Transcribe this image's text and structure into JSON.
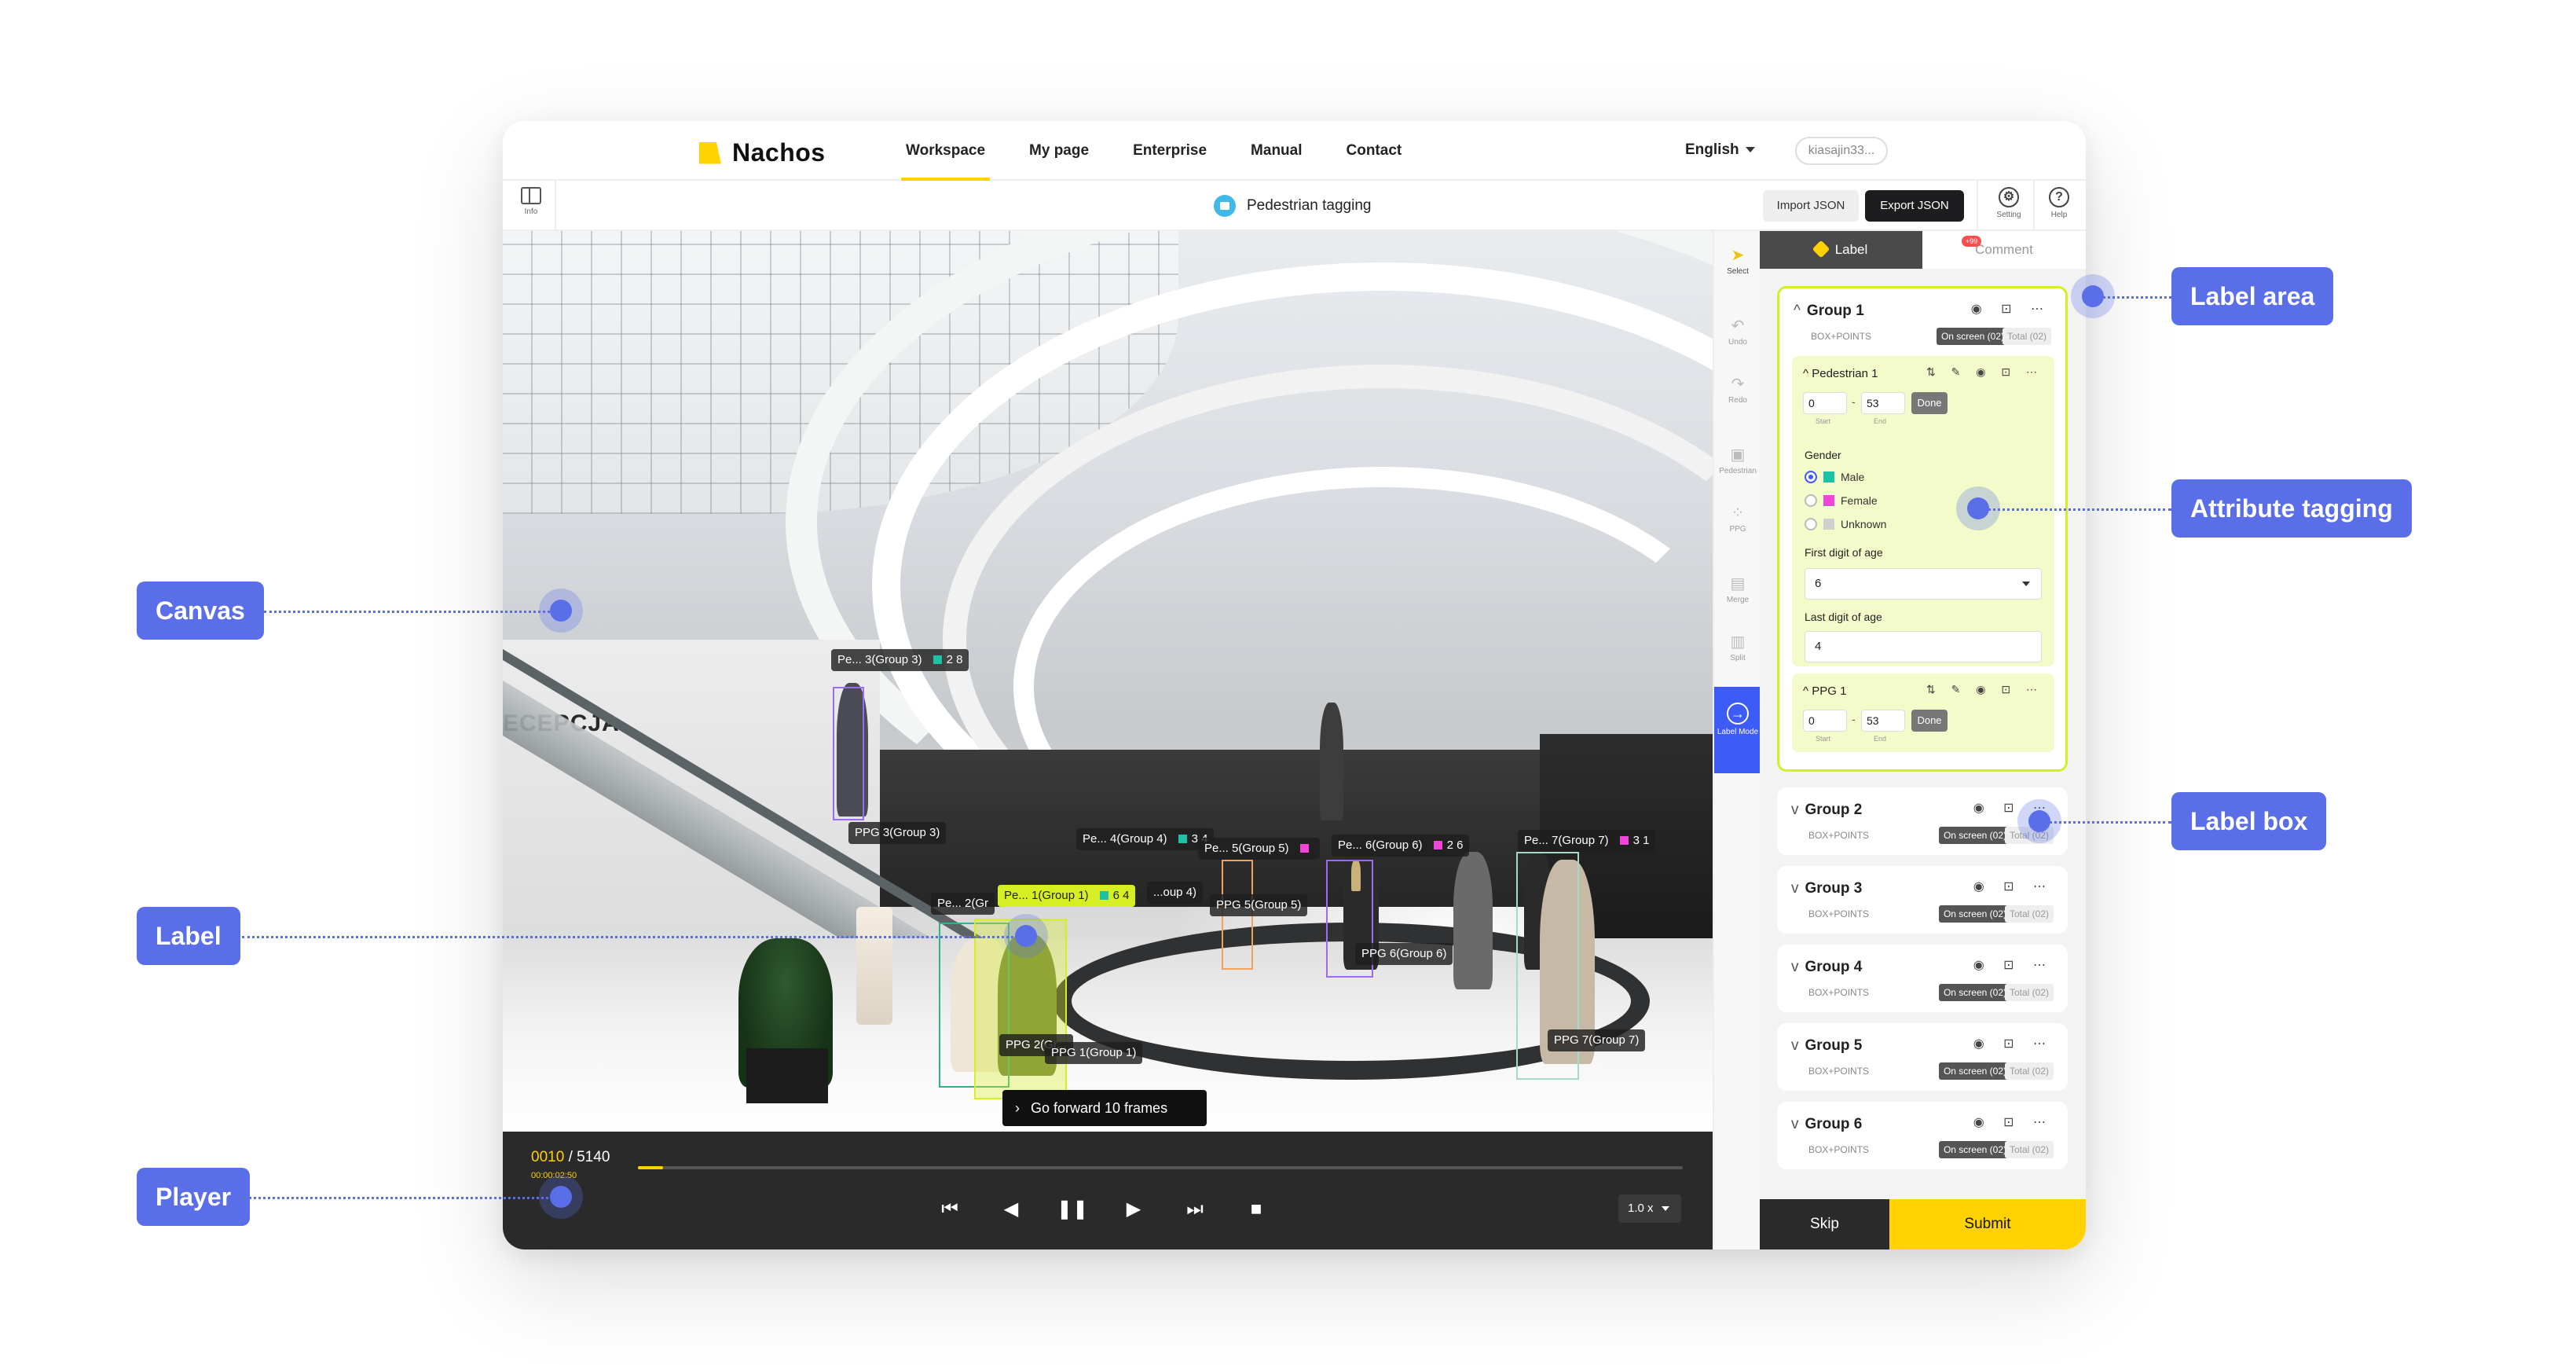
{
  "brand": {
    "name": "Nachos"
  },
  "nav": {
    "links": [
      "Workspace",
      "My page",
      "Enterprise",
      "Manual",
      "Contact"
    ],
    "active": "Workspace",
    "language": "English",
    "user": "kiasajin33..."
  },
  "toolbar": {
    "info_label": "Info",
    "project_name": "Pedestrian tagging",
    "import_label": "Import JSON",
    "export_label": "Export JSON",
    "setting_label": "Setting",
    "help_label": "Help"
  },
  "canvas": {
    "signage": "ECEPCJA",
    "labels": [
      {
        "text": "Pe... 3(Group 3)",
        "swatch": "#1fc1a4",
        "value": "2 8"
      },
      {
        "text": "PPG 3(Group 3)"
      },
      {
        "text": "Pe... 4(Group 4)",
        "swatch": "#1fc1a4",
        "value": "3 4"
      },
      {
        "text": "Pe... 5(Group 5)",
        "swatch": "#f046d7"
      },
      {
        "text": "Pe... 6(Group 6)",
        "swatch": "#f046d7",
        "value": "2 6"
      },
      {
        "text": "Pe... 7(Group 7)",
        "swatch": "#f046d7",
        "value": "3 1"
      },
      {
        "text": "Pe... 2(Gr"
      },
      {
        "text": "Pe... 1(Group 1)",
        "swatch": "#1fc1a4",
        "value": "6 4"
      },
      {
        "text": "...oup 4)"
      },
      {
        "text": "PPG 5(Group 5)"
      },
      {
        "text": "PPG 6(Group 6)"
      },
      {
        "text": "PPG 2(Gr..."
      },
      {
        "text": "PPG 1(Group 1)"
      },
      {
        "text": "PPG 7(Group 7)"
      }
    ],
    "tooltip": "Go forward 10 frames"
  },
  "player": {
    "current_frame": "0010",
    "total_frames": "/ 5140",
    "time": "00:00:02:50",
    "progress": 0.024,
    "speed": "1.0 x"
  },
  "tools": {
    "select": "Select",
    "undo": "Undo",
    "redo": "Redo",
    "pedestrian": "Pedestrian",
    "ppg": "PPG",
    "merge": "Merge",
    "split": "Split",
    "label_mode": "Label Mode"
  },
  "panel": {
    "tab_label": "Label",
    "tab_comment": "Comment",
    "comment_badge": "+99",
    "group_sub": "BOX+POINTS",
    "on_screen": "On screen (02)",
    "total": "Total (02)",
    "groups": [
      "Group 1",
      "Group 2",
      "Group 3",
      "Group 4",
      "Group 5",
      "Group 6"
    ],
    "objects": [
      {
        "name": "Pedestrian 1",
        "start": "0",
        "end": "53"
      },
      {
        "name": "PPG 1",
        "start": "0",
        "end": "53"
      }
    ],
    "start_label": "Start",
    "end_label": "End",
    "done_label": "Done",
    "gender_title": "Gender",
    "genders": [
      {
        "label": "Male",
        "color": "#1fc1a4",
        "selected": true
      },
      {
        "label": "Female",
        "color": "#f046d7",
        "selected": false
      },
      {
        "label": "Unknown",
        "color": "#cfcfcf",
        "selected": false
      }
    ],
    "age_first_title": "First digit of age",
    "age_first_value": "6",
    "age_last_title": "Last digit of age",
    "age_last_value": "4",
    "skip": "Skip",
    "submit": "Submit"
  },
  "callouts": {
    "canvas": "Canvas",
    "label": "Label",
    "player": "Player",
    "label_area": "Label area",
    "attribute_tagging": "Attribute tagging",
    "label_box": "Label box"
  },
  "colors": {
    "accent_yellow": "#ffd200",
    "active_label": "#d6ef24",
    "callout_blue": "#5a6ee8",
    "male_teal": "#1fc1a4",
    "female_pink": "#f046d7"
  }
}
